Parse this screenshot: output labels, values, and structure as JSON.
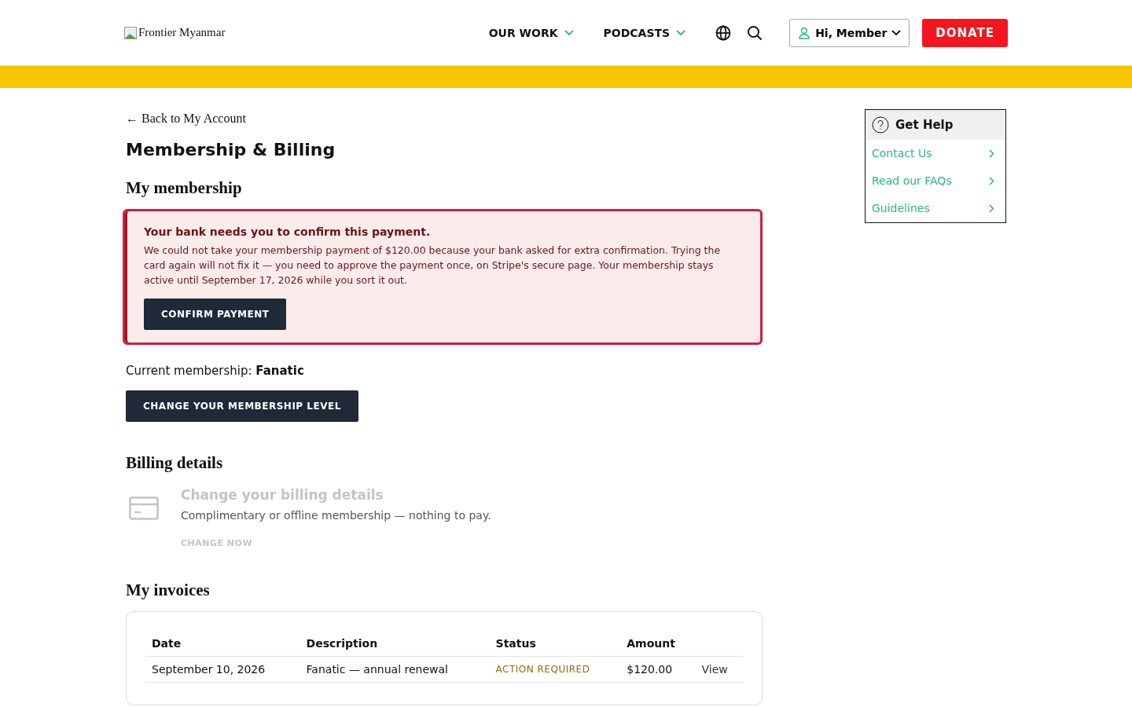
{
  "header": {
    "logo_alt": "Frontier Myanmar",
    "nav": [
      {
        "label": "OUR WORK"
      },
      {
        "label": "PODCASTS"
      }
    ],
    "account": "Hi, Member",
    "donate": "DONATE"
  },
  "back_link": "← Back to My Account",
  "title": "Membership & Billing",
  "membership": {
    "heading": "My membership",
    "alert": {
      "title": "Your bank needs you to confirm this payment.",
      "body": "We could not take your membership payment of $120.00 because your bank asked for extra confirmation. Trying the card again will not fix it — you need to approve the payment once, on Stripe's secure page. Your membership stays active until September 17, 2026 while you sort it out.",
      "button": "CONFIRM PAYMENT"
    },
    "current": "Current membership: **Fanatic**",
    "change_button": "CHANGE YOUR MEMBERSHIP LEVEL"
  },
  "billing": {
    "heading": "Billing details",
    "title": "Change your billing details",
    "description": "Complimentary or offline membership — nothing to pay.",
    "link": "CHANGE NOW",
    "disabled": true
  },
  "invoices": {
    "heading": "My invoices",
    "columns": [
      "Date",
      "Description",
      "Status",
      "Amount"
    ],
    "rows": [
      {
        "date": "September 10, 2026",
        "description": "Fanatic — annual renewal",
        "status": {
          "text": "ACTION REQUIRED",
          "color": "#9a6b10"
        },
        "amount": "$120.00",
        "action": "View"
      }
    ]
  },
  "help": {
    "title": "Get Help",
    "items": [
      "Contact Us",
      "Read our FAQs",
      "Guidelines"
    ]
  }
}
